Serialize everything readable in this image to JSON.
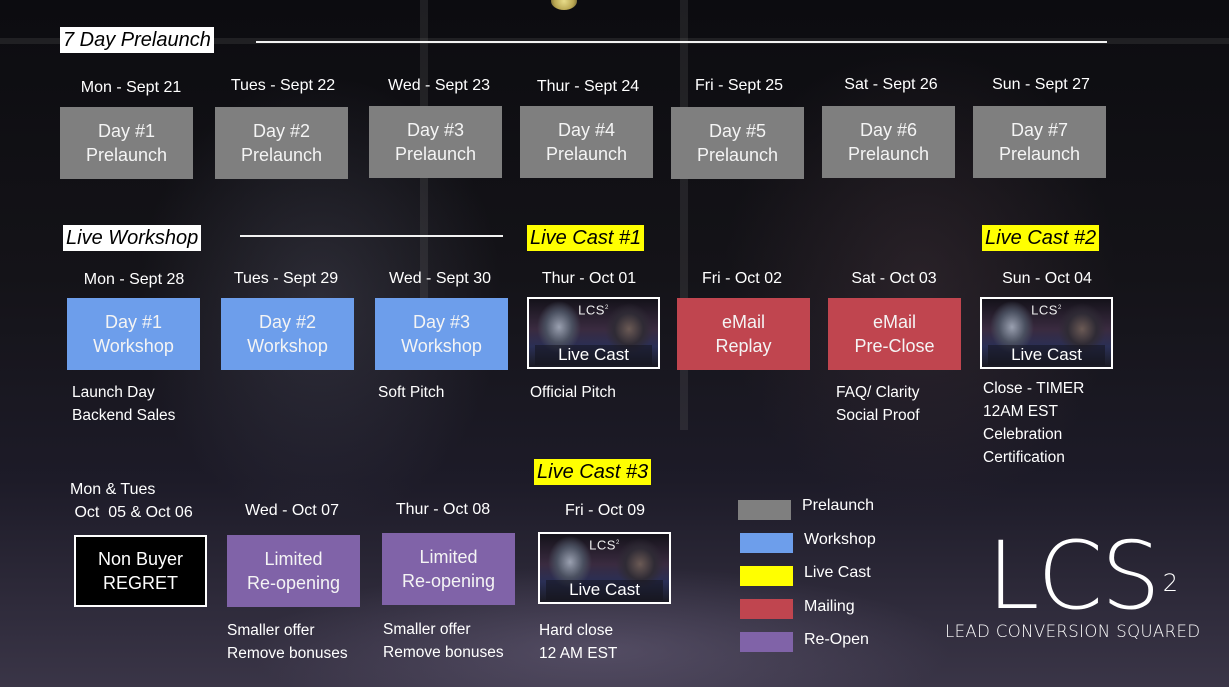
{
  "sections": {
    "prelaunch_title": "7 Day Prelaunch",
    "workshop_title": "Live Workshop",
    "livecast1_title": "Live Cast #1",
    "livecast2_title": "Live Cast #2",
    "livecast3_title": "Live Cast #3"
  },
  "prelaunch": [
    {
      "date": "Mon - Sept  21",
      "line1": "Day #1",
      "line2": "Prelaunch"
    },
    {
      "date": "Tues - Sept  22",
      "line1": "Day #2",
      "line2": "Prelaunch"
    },
    {
      "date": "Wed - Sept  23",
      "line1": "Day #3",
      "line2": "Prelaunch"
    },
    {
      "date": "Thur - Sept  24",
      "line1": "Day #4",
      "line2": "Prelaunch"
    },
    {
      "date": "Fri - Sept  25",
      "line1": "Day #5",
      "line2": "Prelaunch"
    },
    {
      "date": "Sat - Sept  26",
      "line1": "Day #6",
      "line2": "Prelaunch"
    },
    {
      "date": "Sun - Sept  27",
      "line1": "Day #7",
      "line2": "Prelaunch"
    }
  ],
  "week2": [
    {
      "date": "Mon - Sept  28",
      "line1": "Day #1",
      "line2": "Workshop",
      "notes": [
        "Launch Day",
        "Backend Sales"
      ]
    },
    {
      "date": "Tues - Sept  29",
      "line1": "Day #2",
      "line2": "Workshop",
      "notes": []
    },
    {
      "date": "Wed - Sept  30",
      "line1": "Day #3",
      "line2": "Workshop",
      "notes": [
        "Soft Pitch"
      ]
    },
    {
      "date": "Thur - Oct  01",
      "thumb_logo": "LCS",
      "thumb_caption": "Live Cast",
      "notes": [
        "Official Pitch"
      ]
    },
    {
      "date": "Fri - Oct 02",
      "line1": "eMail",
      "line2": "Replay",
      "notes": []
    },
    {
      "date": "Sat - Oct 03",
      "line1": "eMail",
      "line2": "Pre-Close",
      "notes": [
        "FAQ/ Clarity",
        "Social Proof"
      ]
    },
    {
      "date": "Sun - Oct 04",
      "thumb_logo": "LCS",
      "thumb_caption": "Live Cast",
      "notes": [
        "Close - TIMER",
        "12AM EST",
        "Celebration",
        "Certification"
      ]
    }
  ],
  "week3": [
    {
      "date_line1": "Mon & Tues",
      "date_line2": " Oct  05 & Oct 06",
      "line1": "Non Buyer",
      "line2": "REGRET",
      "notes": []
    },
    {
      "date": "Wed - Oct  07",
      "line1": "Limited",
      "line2": "Re-opening",
      "notes": [
        "Smaller offer",
        "Remove bonuses"
      ]
    },
    {
      "date": "Thur - Oct 08",
      "line1": "Limited",
      "line2": "Re-opening",
      "notes": [
        "Smaller offer",
        "Remove bonuses"
      ]
    },
    {
      "date": "Fri - Oct 09",
      "thumb_logo": "LCS",
      "thumb_caption": "Live Cast",
      "notes": [
        "Hard close",
        "12 AM EST"
      ]
    }
  ],
  "legend": [
    {
      "label": "Prelaunch",
      "color": "#7f7f7f"
    },
    {
      "label": "Workshop",
      "color": "#6d9eeb"
    },
    {
      "label": "Live Cast",
      "color": "#ffff00"
    },
    {
      "label": "Mailing",
      "color": "#c0454f"
    },
    {
      "label": "Re-Open",
      "color": "#8063a8"
    }
  ],
  "logo": {
    "mark": "LCS",
    "superscript": "2",
    "tagline": "LEAD CONVERSION SQUARED"
  }
}
